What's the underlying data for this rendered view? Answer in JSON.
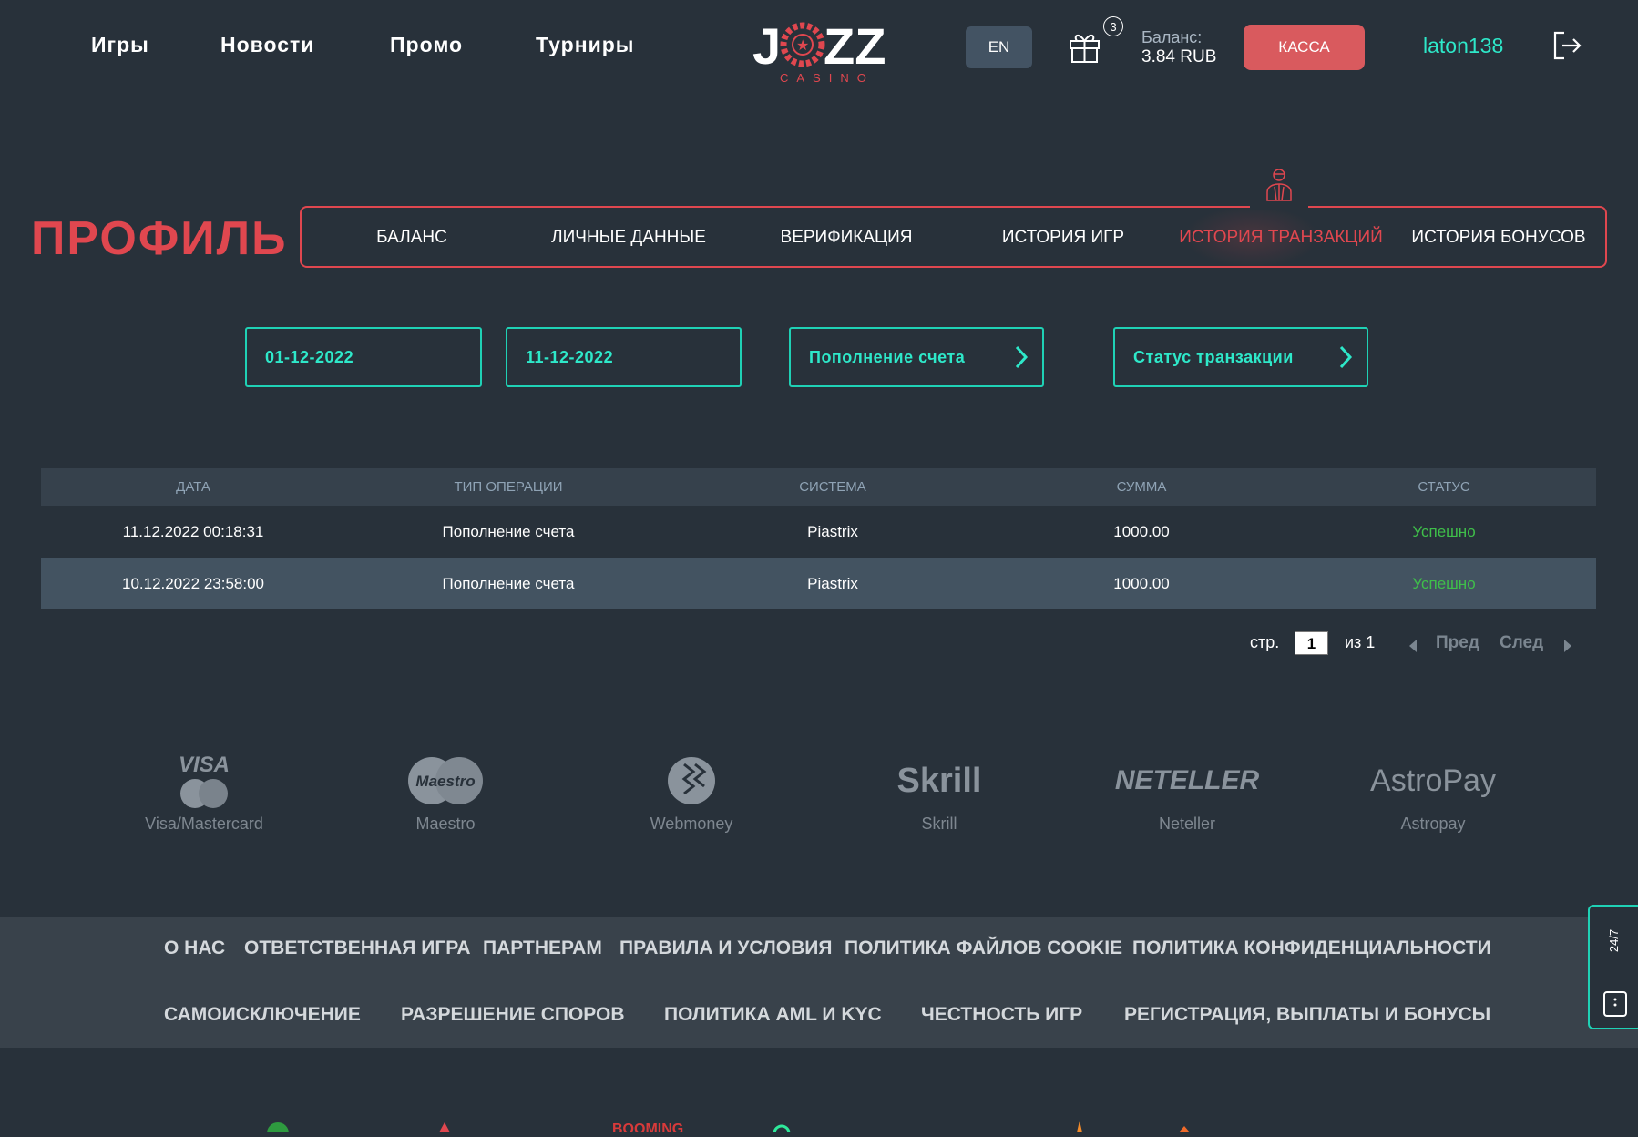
{
  "header": {
    "nav": [
      "Игры",
      "Новости",
      "Промо",
      "Турниры"
    ],
    "logo": "JOZZ CASINO",
    "lang": "EN",
    "gift_count": "3",
    "balance_label": "Баланс:",
    "balance_value": "3.84  RUB",
    "cashier": "КАССА",
    "username": "laton138"
  },
  "profile": {
    "title": "ПРОФИЛЬ",
    "tabs": [
      "БАЛАНС",
      "ЛИЧНЫЕ ДАННЫЕ",
      "ВЕРИФИКАЦИЯ",
      "ИСТОРИЯ ИГР",
      "ИСТОРИЯ ТРАНЗАКЦИЙ",
      "ИСТОРИЯ БОНУСОВ"
    ],
    "active_tab": 4
  },
  "filters": {
    "date_from": "01-12-2022",
    "date_to": "11-12-2022",
    "type": "Пополнение счета",
    "status": "Статус транзакции"
  },
  "table": {
    "headers": [
      "ДАТА",
      "ТИП ОПЕРАЦИИ",
      "СИСТЕМА",
      "СУММА",
      "СТАТУС"
    ],
    "rows": [
      [
        "11.12.2022 00:18:31",
        "Пополнение счета",
        "Piastrix",
        "1000.00",
        "Успешно"
      ],
      [
        "10.12.2022 23:58:00",
        "Пополнение счета",
        "Piastrix",
        "1000.00",
        "Успешно"
      ]
    ]
  },
  "pagination": {
    "page_label": "стр.",
    "page": "1",
    "of": "из 1",
    "prev": "Пред",
    "next": "След"
  },
  "payments": [
    {
      "logo": "VISA",
      "label": "Visa/Mastercard"
    },
    {
      "logo": "Maestro",
      "label": "Maestro"
    },
    {
      "logo": "WM",
      "label": "Webmoney"
    },
    {
      "logo": "Skrill",
      "label": "Skrill"
    },
    {
      "logo": "NETELLER",
      "label": "Neteller"
    },
    {
      "logo": "AstroPay",
      "label": "Astropay"
    }
  ],
  "footer": {
    "row1": [
      "О НАС",
      "ОТВЕТСТВЕННАЯ ИГРА",
      "ПАРТНЕРАМ",
      "ПРАВИЛА И УСЛОВИЯ",
      "ПОЛИТИКА ФАЙЛОВ COOKIE",
      "ПОЛИТИКА КОНФИДЕНЦИАЛЬНОСТИ"
    ],
    "row2": [
      "САМОИСКЛЮЧЕНИЕ",
      "РАЗРЕШЕНИЕ СПОРОВ",
      "ПОЛИТИКА AML И KYC",
      "ЧЕСТНОСТЬ ИГР",
      "РЕГИСТРАЦИЯ, ВЫПЛАТЫ И БОНУСЫ"
    ]
  },
  "support": {
    "label": "24/7"
  },
  "colors": {
    "bg": "#28313a",
    "accent_red": "#e0474f",
    "accent_teal": "#1fd1b5",
    "success": "#3fbf4a"
  }
}
